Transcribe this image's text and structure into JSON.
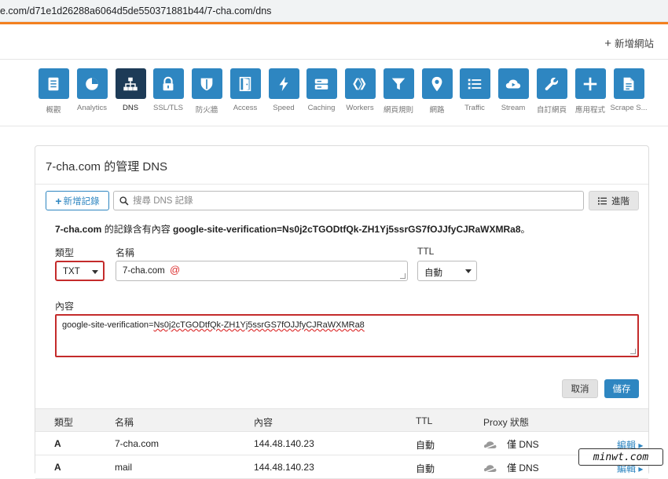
{
  "browser": {
    "url": "e.com/d71e1d26288a6064d5de550371881b44/7-cha.com/dns"
  },
  "topnav": {
    "add_site_plus": "+",
    "add_site": "新增網站"
  },
  "apps": [
    {
      "label": "概觀",
      "icon": "overview-icon"
    },
    {
      "label": "Analytics",
      "icon": "analytics-icon"
    },
    {
      "label": "DNS",
      "icon": "dns-icon",
      "active": true
    },
    {
      "label": "SSL/TLS",
      "icon": "lock-icon"
    },
    {
      "label": "防火牆",
      "icon": "shield-icon"
    },
    {
      "label": "Access",
      "icon": "door-icon"
    },
    {
      "label": "Speed",
      "icon": "lightning-icon"
    },
    {
      "label": "Caching",
      "icon": "server-icon"
    },
    {
      "label": "Workers",
      "icon": "workers-icon"
    },
    {
      "label": "網頁規則",
      "icon": "filter-icon"
    },
    {
      "label": "網路",
      "icon": "location-pin-icon"
    },
    {
      "label": "Traffic",
      "icon": "list-icon"
    },
    {
      "label": "Stream",
      "icon": "cloud-play-icon"
    },
    {
      "label": "自訂網頁",
      "icon": "wrench-icon"
    },
    {
      "label": "應用程式",
      "icon": "plus-icon"
    },
    {
      "label": "Scrape S...",
      "icon": "document-icon"
    }
  ],
  "dns": {
    "title": "7-cha.com 的管理 DNS",
    "add_record": "新增記錄",
    "add_record_plus": "+",
    "search_placeholder": "搜尋 DNS 記錄",
    "advanced": "進階",
    "info_domain": "7-cha.com",
    "info_mid": " 的記錄含有內容 ",
    "info_value": "google-site-verification=Ns0j2cTGODtfQk-ZH1Yj5ssrGS7fOJJfyCJRaWXMRa8",
    "info_end": "。",
    "form": {
      "type_label": "類型",
      "type_value": "TXT",
      "name_label": "名稱",
      "name_value": "7-cha.com",
      "name_at": "@",
      "ttl_label": "TTL",
      "ttl_value": "自動",
      "content_label": "內容",
      "content_prefix": "google-site-verification=",
      "content_token": "Ns0j2cTGODtfQk-ZH1Yj5ssrGS7fOJJfyCJRaWXMRa8",
      "cancel": "取消",
      "save": "儲存"
    },
    "table": {
      "headers": [
        "類型",
        "名稱",
        "內容",
        "TTL",
        "Proxy 狀態"
      ],
      "rows": [
        {
          "type": "A",
          "name": "7-cha.com",
          "content": "144.48.140.23",
          "ttl": "自動",
          "proxy": "僅 DNS",
          "edit": "編輯 ▸"
        },
        {
          "type": "A",
          "name": "mail",
          "content": "144.48.140.23",
          "ttl": "自動",
          "proxy": "僅 DNS",
          "edit": "編輯 ▸"
        }
      ]
    }
  },
  "watermark": "minwt.com",
  "colors": {
    "accent": "#2e86c1",
    "active_tile": "#1d3b57",
    "highlight": "#c42b2b",
    "brand_orange": "#f38020"
  }
}
